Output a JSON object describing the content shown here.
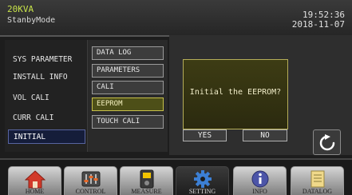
{
  "status": {
    "model": "20KVA",
    "mode": "StanbyMode",
    "time": "19:52:36",
    "date": "2018-11-07"
  },
  "left_menu": [
    {
      "label": "SYS PARAMETER",
      "active": false
    },
    {
      "label": "INSTALL INFO",
      "active": false
    },
    {
      "label": "VOL CALI",
      "active": false
    },
    {
      "label": "CURR CALI",
      "active": false
    },
    {
      "label": "INITIAL",
      "active": true
    }
  ],
  "sub_menu": [
    {
      "label": "DATA LOG",
      "active": false
    },
    {
      "label": "PARAMETERS",
      "active": false
    },
    {
      "label": "CALI",
      "active": false
    },
    {
      "label": "EEPROM",
      "active": true
    },
    {
      "label": "TOUCH CALI",
      "active": false
    }
  ],
  "dialog": {
    "message": "Initial the EEPROM?",
    "yes_label": "YES",
    "no_label": "NO"
  },
  "icons": {
    "refresh": "refresh-icon"
  },
  "bottom_tabs": [
    {
      "label": "HOME",
      "icon": "home-icon",
      "active": false
    },
    {
      "label": "CONTROL",
      "icon": "sliders-icon",
      "active": false
    },
    {
      "label": "MEASURE",
      "icon": "meter-icon",
      "active": false
    },
    {
      "label": "SETTING",
      "icon": "gear-icon",
      "active": true
    },
    {
      "label": "INFO",
      "icon": "info-icon",
      "active": false
    },
    {
      "label": "DATALOG",
      "icon": "datalog-icon",
      "active": false
    }
  ],
  "colors": {
    "accent_active_menu": "#151d3a",
    "accent_active_sub": "#4d4f18",
    "model_text": "#c7e24a",
    "gear_blue": "#3c7fd4"
  }
}
